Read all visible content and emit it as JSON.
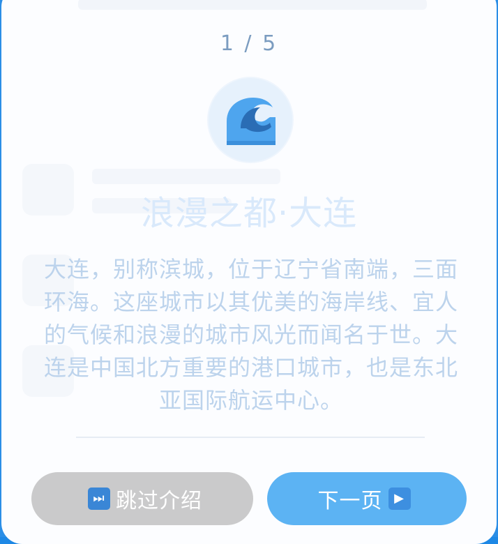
{
  "modal": {
    "counter": "1 / 5",
    "icon": "ocean-wave-icon",
    "title": "浪漫之都·大连",
    "description": "大连，别称滨城，位于辽宁省南端，三面环海。这座城市以其优美的海岸线、宜人的气候和浪漫的城市风光而闻名于世。大连是中国北方重要的港口城市，也是东北亚国际航运中心。"
  },
  "buttons": {
    "skip_icon": "skip-forward-icon",
    "skip_label": "跳过介绍",
    "next_label": "下一页",
    "next_icon": "play-icon"
  },
  "colors": {
    "accent": "#5cb3f3",
    "skip_bg": "#cacacb",
    "counter": "#7b9cc0"
  }
}
